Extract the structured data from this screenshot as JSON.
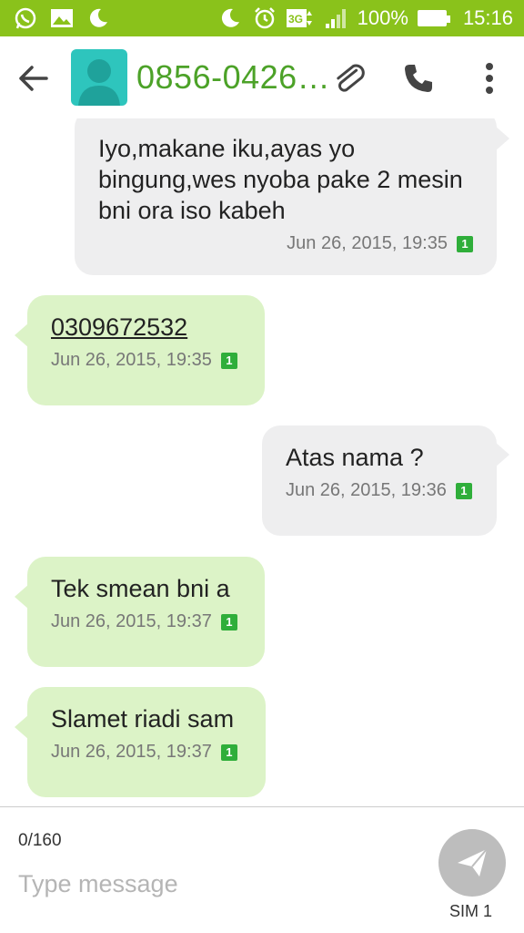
{
  "status_bar": {
    "battery": "100%",
    "time": "15:16",
    "network": "3G"
  },
  "toolbar": {
    "contact_name": "0856-0426…"
  },
  "messages": [
    {
      "direction": "sent",
      "text": "Iyo,makane iku,ayas yo\nbingung,wes nyoba pake 2 mesin\nbni ora iso kabeh",
      "timestamp": "Jun 26, 2015, 19:35",
      "sim": "1"
    },
    {
      "direction": "received",
      "text": "0309672532",
      "timestamp": "Jun 26, 2015, 19:35",
      "sim": "1"
    },
    {
      "direction": "sent",
      "text": "Atas nama ?",
      "timestamp": "Jun 26, 2015, 19:36",
      "sim": "1"
    },
    {
      "direction": "received",
      "text": "Tek smean bni a",
      "timestamp": "Jun 26, 2015, 19:37",
      "sim": "1"
    },
    {
      "direction": "received",
      "text": "Slamet riadi sam",
      "timestamp": "Jun 26, 2015, 19:37",
      "sim": "1"
    }
  ],
  "composer": {
    "counter": "0/160",
    "placeholder": "Type message",
    "sim_label": "SIM 1"
  },
  "colors": {
    "status_bar": "#8ac21b",
    "contact_name": "#4ca228",
    "sent_bubble": "#eeeeef",
    "received_bubble": "#dcf3c7",
    "sim_badge": "#2fae3a",
    "link": "#1c9c8a"
  }
}
